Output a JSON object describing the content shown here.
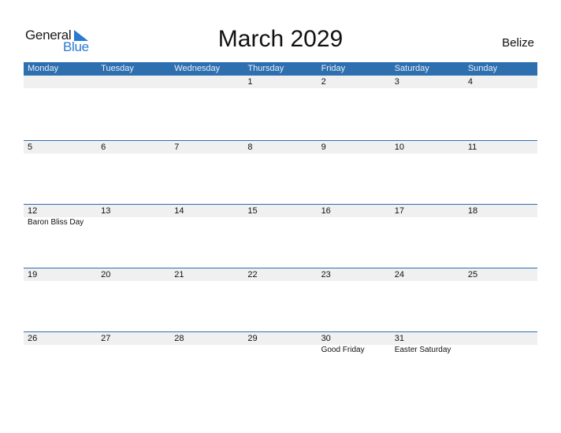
{
  "logo": {
    "general": "General",
    "blue": "Blue"
  },
  "title": "March 2029",
  "country": "Belize",
  "colors": {
    "header_bg": "#2e6fb0",
    "day_bar_bg": "#f0f0f0",
    "brand_blue": "#2a7bd0"
  },
  "weekdays": [
    "Monday",
    "Tuesday",
    "Wednesday",
    "Thursday",
    "Friday",
    "Saturday",
    "Sunday"
  ],
  "weeks": [
    {
      "days": [
        "",
        "",
        "",
        "1",
        "2",
        "3",
        "4"
      ],
      "events": [
        "",
        "",
        "",
        "",
        "",
        "",
        ""
      ]
    },
    {
      "days": [
        "5",
        "6",
        "7",
        "8",
        "9",
        "10",
        "11"
      ],
      "events": [
        "",
        "",
        "",
        "",
        "",
        "",
        ""
      ]
    },
    {
      "days": [
        "12",
        "13",
        "14",
        "15",
        "16",
        "17",
        "18"
      ],
      "events": [
        "Baron Bliss Day",
        "",
        "",
        "",
        "",
        "",
        ""
      ]
    },
    {
      "days": [
        "19",
        "20",
        "21",
        "22",
        "23",
        "24",
        "25"
      ],
      "events": [
        "",
        "",
        "",
        "",
        "",
        "",
        ""
      ]
    },
    {
      "days": [
        "26",
        "27",
        "28",
        "29",
        "30",
        "31",
        ""
      ],
      "events": [
        "",
        "",
        "",
        "",
        "Good Friday",
        "Easter Saturday",
        ""
      ]
    }
  ]
}
